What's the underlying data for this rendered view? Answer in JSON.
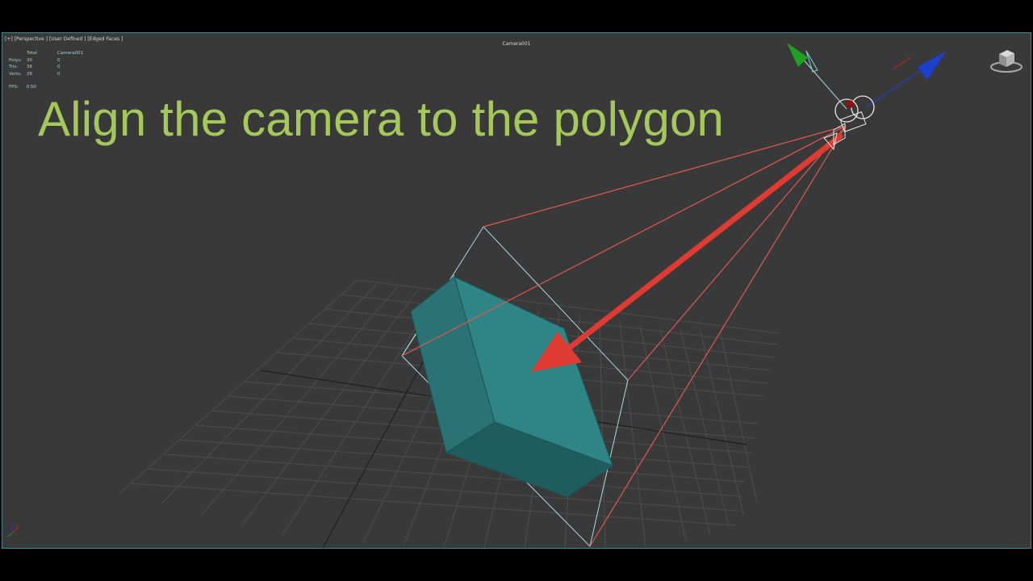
{
  "viewport": {
    "label": "[+] [Perspective ] [User Defined ] [Edged Faces ]",
    "camera_name": "Camera001"
  },
  "stats": {
    "headers": [
      "",
      "Total",
      "Camera001"
    ],
    "rows": [
      {
        "label": "Polys:",
        "total": "30",
        "selected": "0"
      },
      {
        "label": "Tris:",
        "total": "36",
        "selected": "0"
      },
      {
        "label": "Verts:",
        "total": "26",
        "selected": "0"
      }
    ],
    "fps_label": "FPS:",
    "fps_value": "0.50"
  },
  "overlay_title": "Align the camera to the polygon",
  "colors": {
    "viewport_bg": "#393939",
    "viewport_border": "#3f8b95",
    "grid": "#4e4e4e",
    "grid_axis": "#1e1e1e",
    "box_face": "#2e7c7e",
    "frustum": "#e05a4c",
    "target_frame": "#a8dbe8",
    "arrow": "#e03b33",
    "title": "#a4c85a",
    "axis_x": "#cc2222",
    "axis_y": "#1fa01f",
    "axis_z": "#1d3fcc"
  },
  "icons": {
    "viewcube": "viewcube-icon",
    "camera": "camera-icon",
    "axis_tripod": "axis-tripod-icon"
  }
}
